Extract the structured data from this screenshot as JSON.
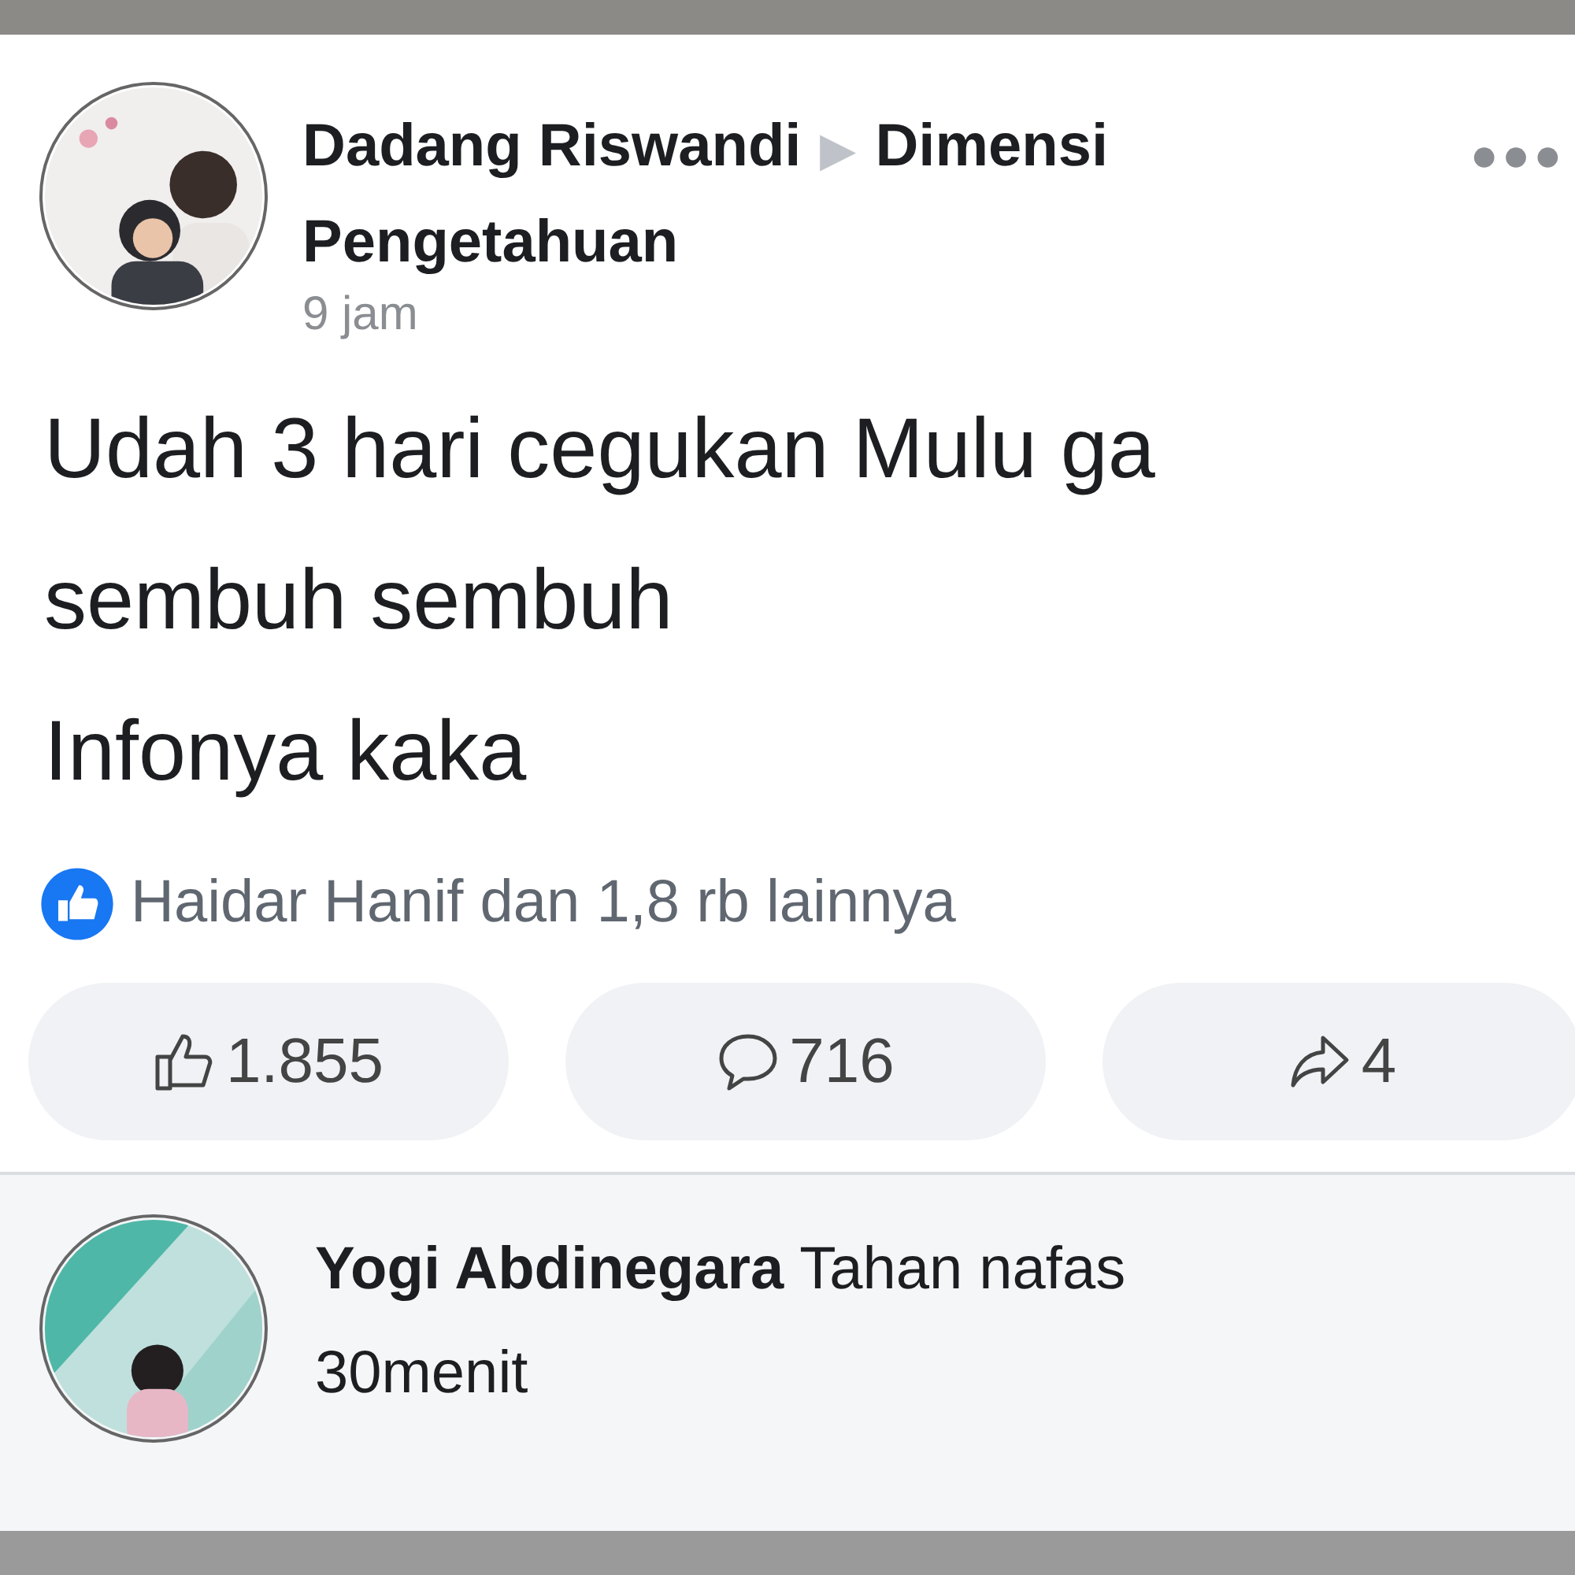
{
  "post": {
    "author": "Dadang Riswandi",
    "separator": "▶",
    "group": "Dimensi Pengetahuan",
    "time": "9 jam",
    "text_lines": [
      "Udah 3 hari cegukan Mulu ga",
      "sembuh sembuh",
      "Infonya kaka"
    ],
    "reactions": "Haidar Hanif dan 1,8 rb lainnya",
    "actions": [
      {
        "kind": "like",
        "count": "1.855"
      },
      {
        "kind": "comment",
        "count": "716"
      },
      {
        "kind": "share",
        "count": "4"
      }
    ]
  },
  "comment": {
    "text": "**Yogi Abdinegara** Tahan nafas 30menit"
  }
}
